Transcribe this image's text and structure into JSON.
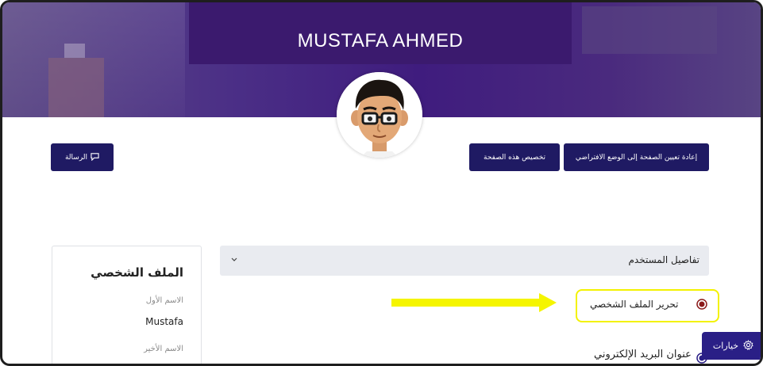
{
  "profile": {
    "name": "MUSTAFA AHMED"
  },
  "buttons": {
    "message": "الرسالة",
    "customize": "تخصيص هذه الصفحة",
    "reset": "إعادة تعيين الصفحة إلى الوضع الافتراضي"
  },
  "details": {
    "section_label": "تفاصيل المستخدم",
    "edit_profile": "تحرير الملف الشخصي",
    "email_address": "عنوان البريد الإلكتروني"
  },
  "sidebar_card": {
    "title": "الملف الشخصي",
    "first_name_label": "الاسم الأول",
    "first_name_value": "Mustafa",
    "last_name_label": "الاسم الأخير"
  },
  "options": {
    "label": "خيارات"
  },
  "colors": {
    "primary_button": "#1f1a63",
    "highlight": "#f3f200",
    "radio": "#8b1a1a",
    "banner": "#3f1c7e"
  },
  "icons": {
    "message": "message-icon",
    "chevron": "chevron-down-icon",
    "options": "gear-icon"
  }
}
